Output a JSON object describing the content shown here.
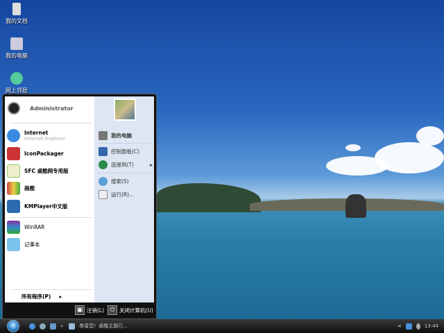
{
  "desktop": {
    "icons": [
      {
        "label": "我的文档",
        "icon": "documents-icon"
      },
      {
        "label": "我的电脑",
        "icon": "computer-icon"
      },
      {
        "label": "网上邻居",
        "icon": "network-icon"
      }
    ]
  },
  "start_menu": {
    "user": "Administrator",
    "pinned": [
      {
        "label": "Internet",
        "sub": "Internet Explorer",
        "icon": "ie-icon"
      },
      {
        "label": "IconPackager",
        "icon": "iconpackager-icon"
      },
      {
        "label": "SFC 桌酷网专用版",
        "icon": "sfc-icon"
      },
      {
        "label": "画图",
        "icon": "paint-icon"
      },
      {
        "label": "KMPlayer中文版",
        "icon": "kmplayer-icon"
      }
    ],
    "recent": [
      {
        "label": "WinRAR",
        "icon": "winrar-icon"
      },
      {
        "label": "记事本",
        "icon": "notepad-icon"
      }
    ],
    "all_programs": "所有程序(P)",
    "right": [
      {
        "label": "我的电脑",
        "icon": "computer-icon"
      },
      {
        "label": "控制面板(C)",
        "icon": "control-panel-icon"
      },
      {
        "label": "连接到(T)",
        "icon": "connect-icon"
      },
      {
        "label": "搜索(S)",
        "icon": "search-icon"
      },
      {
        "label": "运行(R)...",
        "icon": "run-icon"
      }
    ],
    "logoff": "注销(L)",
    "shutdown": "关闭计算机(U)"
  },
  "taskbar": {
    "task": "恭喜您！桌酷主题已...",
    "clock": "13:44",
    "overflow": "»",
    "tray_arrow": "<"
  },
  "colors": {
    "taskbar": "#0c0c0c",
    "menu_right": "#dde6f2"
  }
}
